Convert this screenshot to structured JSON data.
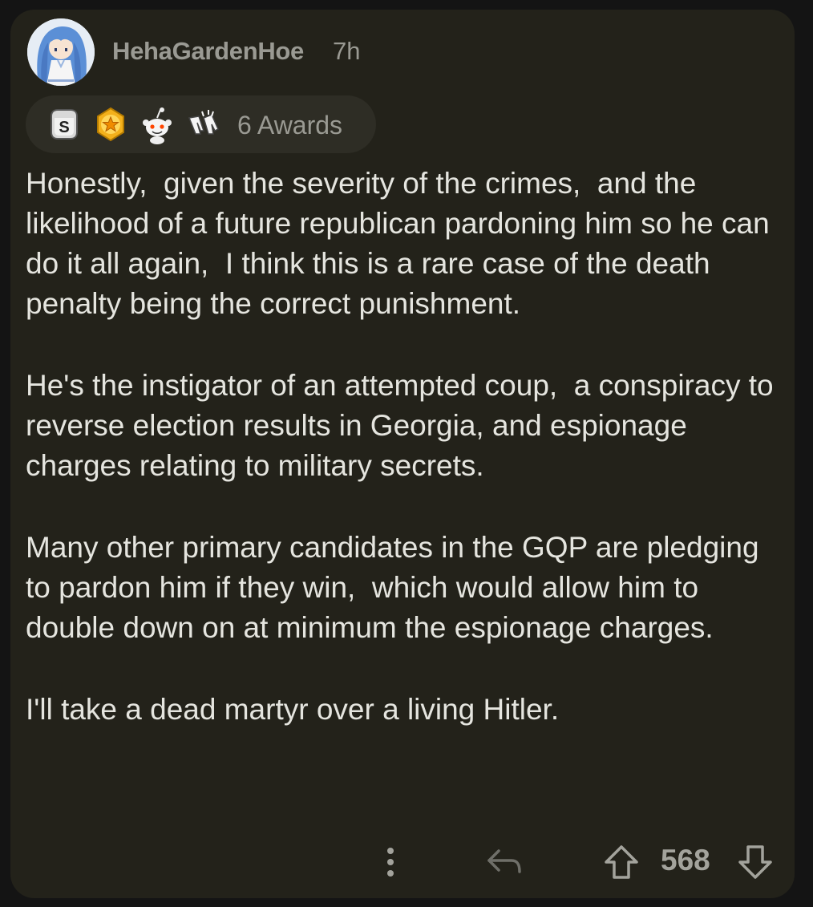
{
  "comment": {
    "username": "HehaGardenHoe",
    "time_ago": "7h",
    "awards": {
      "icons": [
        "silver-s-award-icon",
        "gold-star-award-icon",
        "snoo-award-icon",
        "hands-award-icon"
      ],
      "count_label": "6 Awards"
    },
    "paragraphs": [
      "Honestly,  given the severity of the crimes,  and the likelihood of a future republican pardoning him so he can do it all again,  I think this is a rare case of the death penalty being the correct punishment.",
      "He's the instigator of an attempted coup,  a conspiracy to reverse election results in Georgia, and espionage charges relating to military secrets.",
      "Many other primary candidates in the GQP are pledging to pardon him if they win,  which would allow him to double down on at minimum the espionage charges.",
      "I'll take a dead martyr over a living Hitler."
    ],
    "score": "568"
  },
  "colors": {
    "background": "#141414",
    "card": "#23221a",
    "text": "#e5e5df",
    "muted": "#9a9a93"
  }
}
